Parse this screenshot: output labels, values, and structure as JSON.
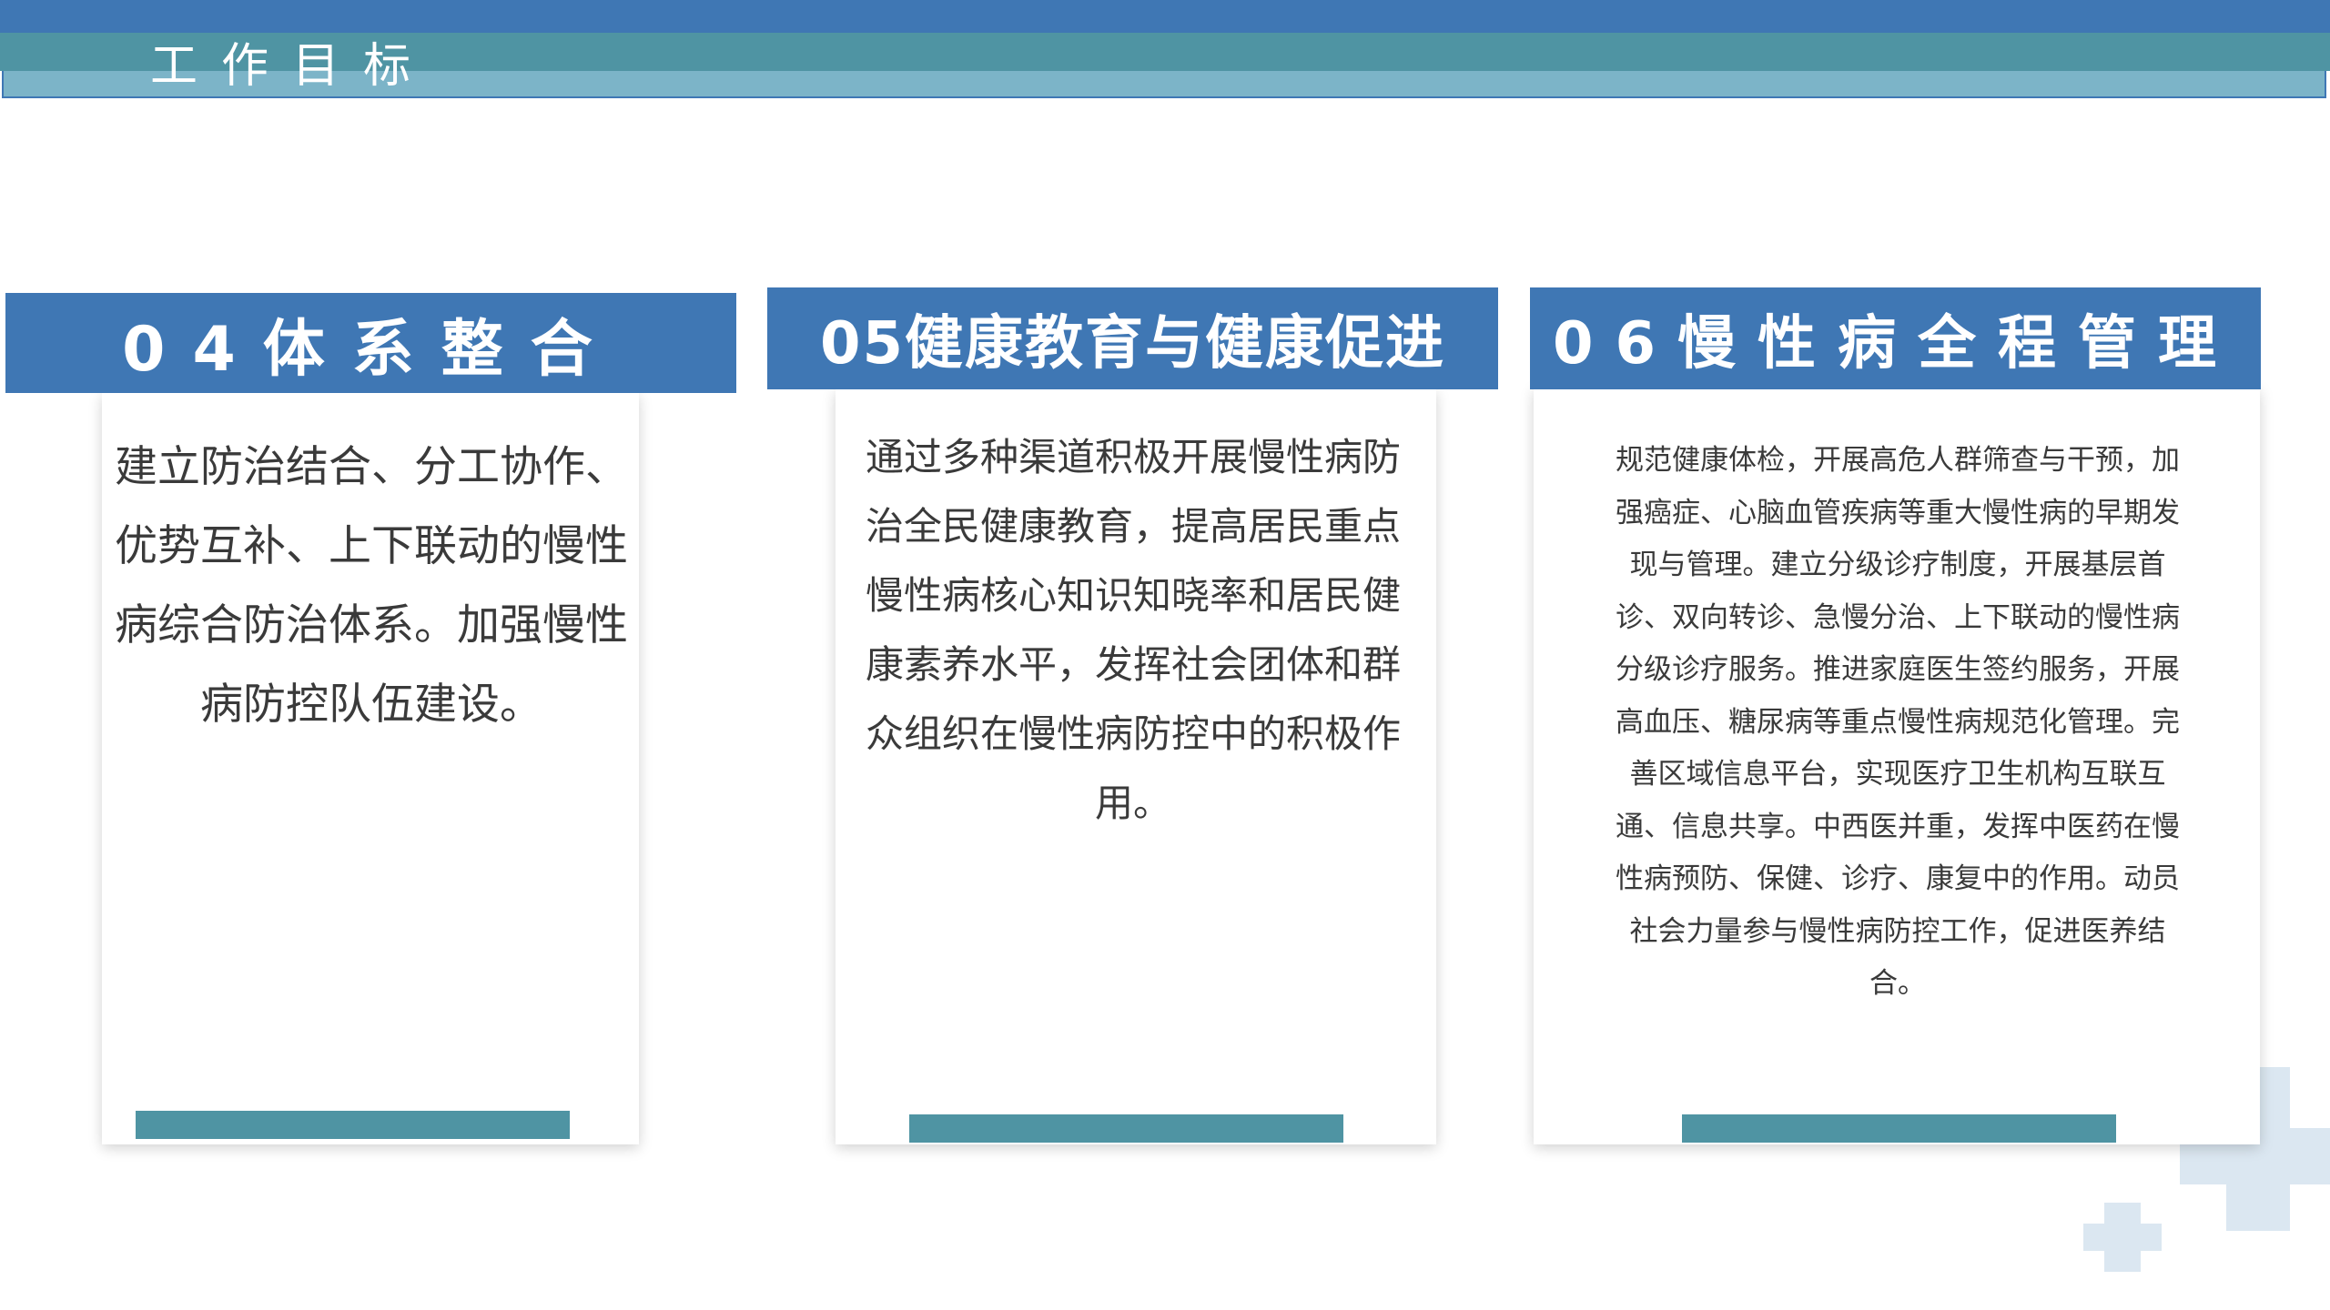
{
  "page": {
    "title": "工作目标"
  },
  "cards": [
    {
      "heading": "04体系整合",
      "body": "建立防治结合、分工协作、优势互补、上下联动的慢性病综合防治体系。加强慢性病防控队伍建设。"
    },
    {
      "heading": "05健康教育与健康促进",
      "body": "通过多种渠道积极开展慢性病防治全民健康教育，提高居民重点慢性病核心知识知晓率和居民健康素养水平，发挥社会团体和群众组织在慢性病防控中的积极作用。"
    },
    {
      "heading": "06慢性病全程管理",
      "body": "规范健康体检，开展高危人群筛查与干预，加强癌症、心脑血管疾病等重大慢性病的早期发现与管理。建立分级诊疗制度，开展基层首诊、双向转诊、急慢分治、上下联动的慢性病分级诊疗服务。推进家庭医生签约服务，开展高血压、糖尿病等重点慢性病规范化管理。完善区域信息平台，实现医疗卫生机构互联互通、信息共享。中西医并重，发挥中医药在慢性病预防、保健、诊疗、康复中的作用。动员社会力量参与慢性病防控工作，促进医养结合。"
    }
  ],
  "colors": {
    "header_blue": "#3f77b4",
    "header_teal": "#4f94a3",
    "header_light": "#7cb4c8",
    "card_footer": "#4f94a3",
    "decor_plus": "#dbe7f1"
  },
  "icons": {
    "decor": "plus-cross-icon"
  }
}
